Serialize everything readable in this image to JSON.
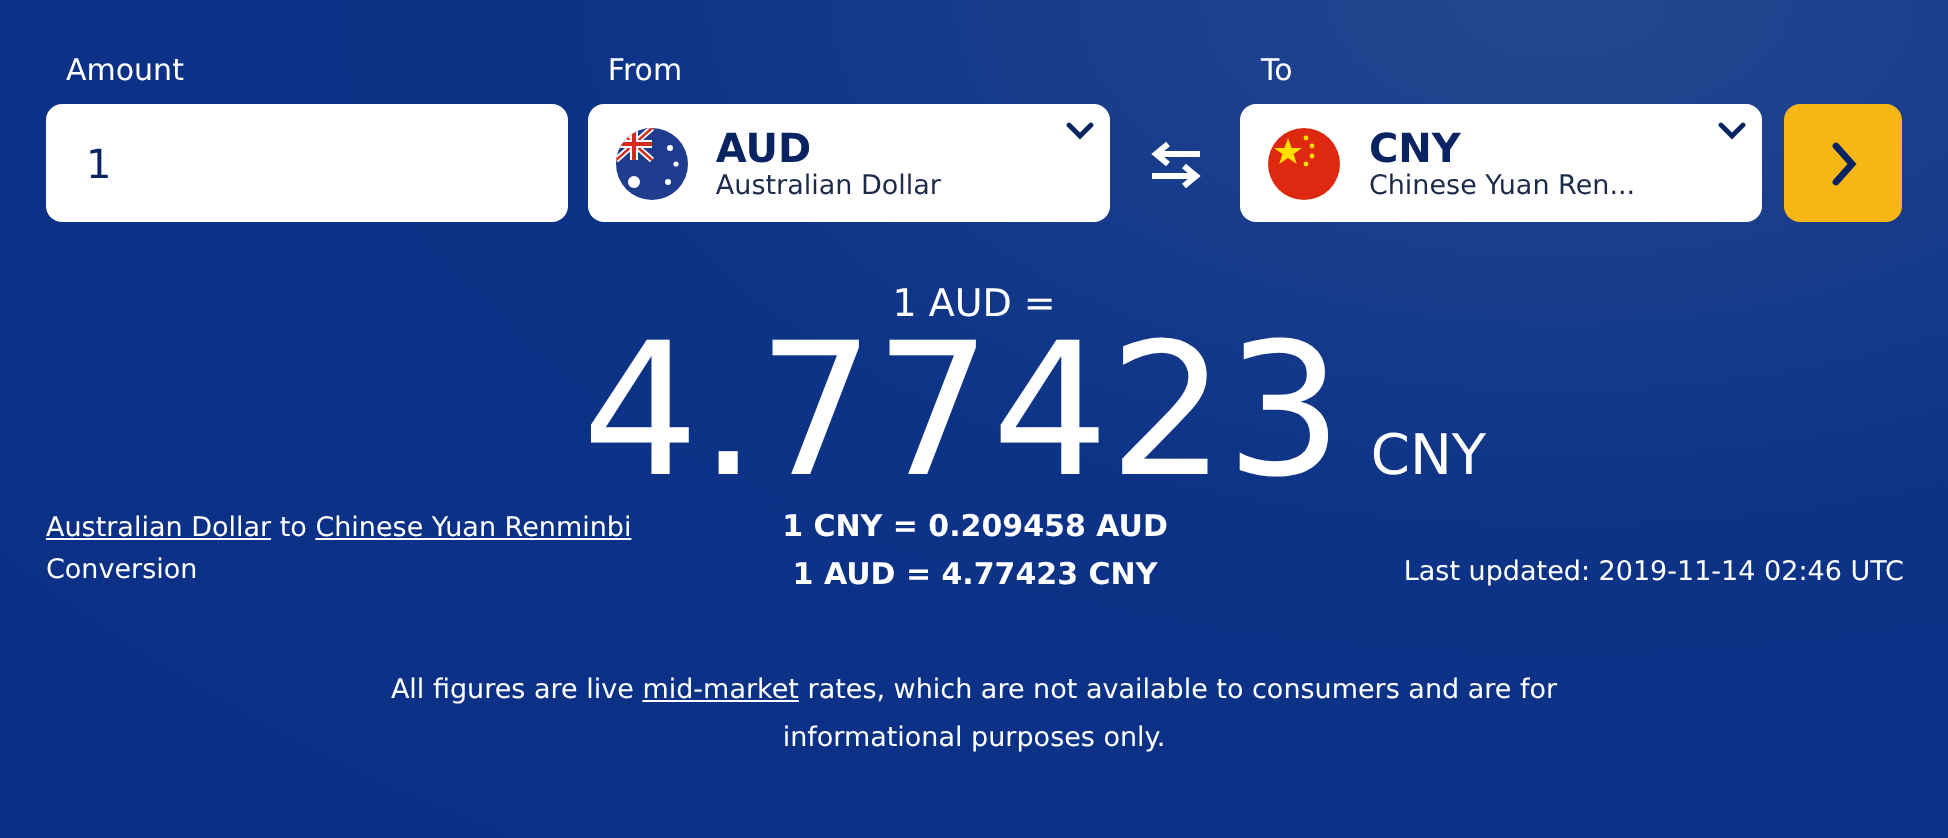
{
  "amount": {
    "label": "Amount",
    "value": "1"
  },
  "from": {
    "label": "From",
    "code": "AUD",
    "name": "Australian Dollar",
    "kind": "au"
  },
  "to": {
    "label": "To",
    "code": "CNY",
    "name": "Chinese Yuan Ren...",
    "kind": "cn"
  },
  "result": {
    "base": "1 AUD =",
    "value": "4.77423",
    "unit": "CNY"
  },
  "conversion_title": {
    "from_link": "Australian Dollar",
    "connector": "to",
    "to_link": "Chinese Yuan Renminbi",
    "suffix": "Conversion"
  },
  "rates": [
    "1 CNY = 0.209458 AUD",
    "1 AUD = 4.77423 CNY"
  ],
  "last_updated": "Last updated: 2019-11-14 02:46 UTC",
  "disclaimer": {
    "before": "All figures are live",
    "link": "mid-market",
    "after": "rates, which are not available to consumers and are for informational purposes only."
  }
}
